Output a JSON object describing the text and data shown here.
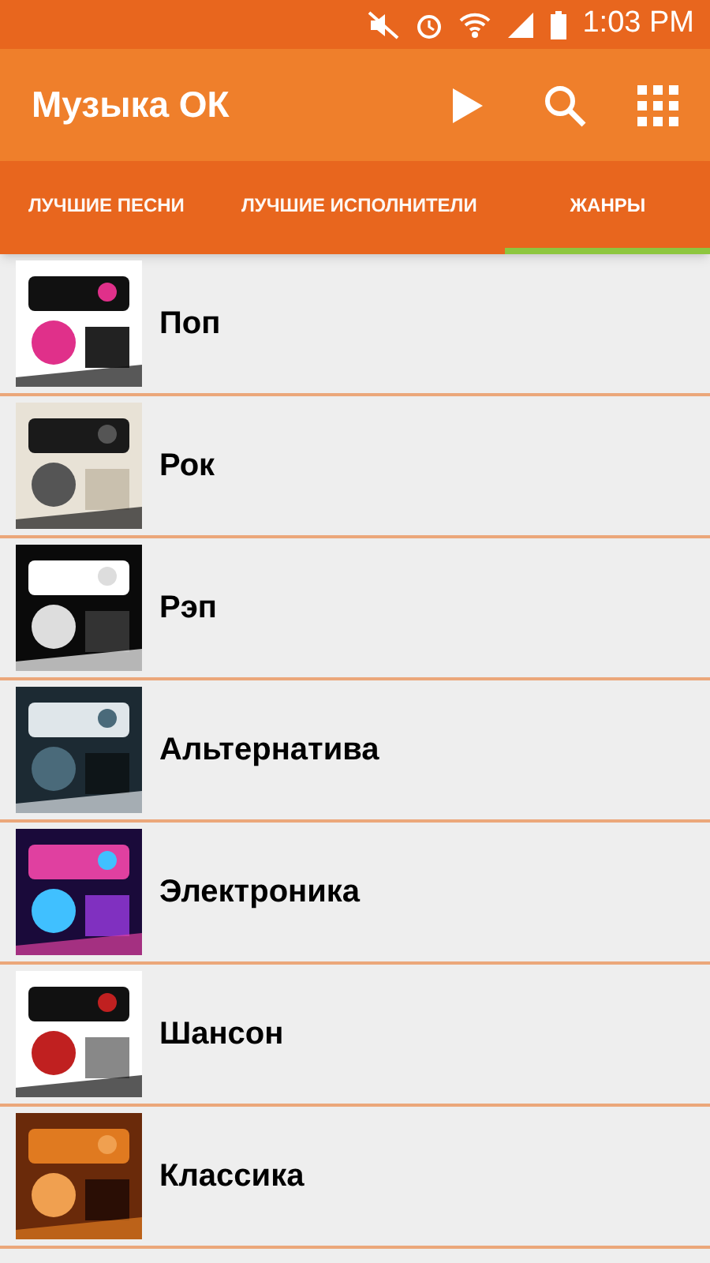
{
  "status_bar": {
    "time": "1:03 PM"
  },
  "app_bar": {
    "title": "Музыка ОК"
  },
  "tabs": [
    {
      "label": "ЛУЧШИЕ ПЕСНИ",
      "selected": false
    },
    {
      "label": "ЛУЧШИЕ ИСПОЛНИТЕЛИ",
      "selected": false
    },
    {
      "label": "ЖАНРЫ",
      "selected": true
    }
  ],
  "genres": [
    {
      "name": "Поп",
      "kind": "picture"
    },
    {
      "name": "Рок",
      "kind": "picture"
    },
    {
      "name": "Рэп",
      "kind": "picture"
    },
    {
      "name": "Альтернатива",
      "kind": "picture"
    },
    {
      "name": "Электроника",
      "kind": "picture"
    },
    {
      "name": "Шансон",
      "kind": "picture"
    },
    {
      "name": "Классика",
      "kind": "picture"
    }
  ]
}
